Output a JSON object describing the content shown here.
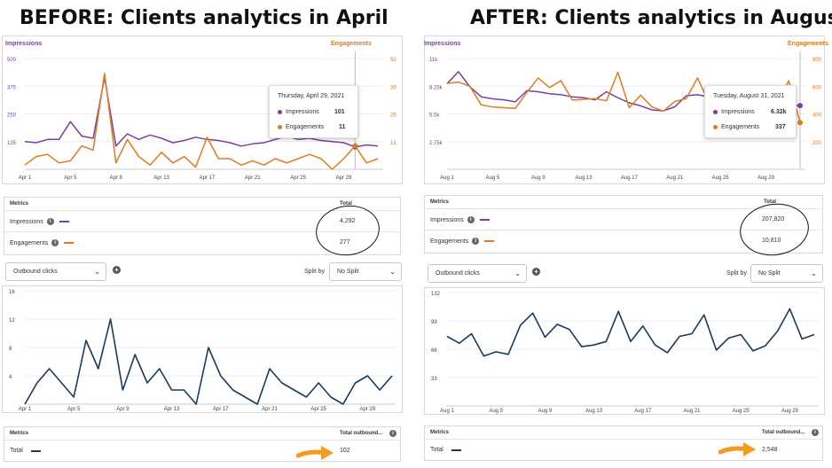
{
  "colors": {
    "impressions": "#7b3fa0",
    "engagements": "#e07b1f",
    "clicks": "#1b3a5c",
    "annotation_arrow": "#f39c1f"
  },
  "left": {
    "title": "BEFORE: Clients analytics in April",
    "top_legend": {
      "left": "Impressions",
      "right": "Engagements"
    },
    "tooltip": {
      "date": "Thursday, April 29, 2021",
      "impressions_label": "Impressions",
      "impressions_value": "101",
      "engagements_label": "Engagements",
      "engagements_value": "11"
    },
    "metrics_table": {
      "col_metric": "Metrics",
      "col_total": "Total",
      "rows": [
        {
          "label": "Impressions",
          "value": "4,292"
        },
        {
          "label": "Engagements",
          "value": "277"
        }
      ]
    },
    "dropdown": {
      "value": "Outbound clicks"
    },
    "split": {
      "label": "Split by",
      "value": "No Split"
    },
    "bottom_table": {
      "col_metric": "Metrics",
      "col_total": "Total outbound...",
      "row_label": "Total",
      "row_value": "102"
    }
  },
  "right": {
    "title": "AFTER: Clients analytics in August",
    "top_legend": {
      "left": "Impressions",
      "right": "Engagements"
    },
    "tooltip": {
      "date": "Tuesday, August 31, 2021",
      "impressions_label": "Impressions",
      "impressions_value": "6.32k",
      "engagements_label": "Engagements",
      "engagements_value": "337"
    },
    "metrics_table": {
      "col_metric": "Metrics",
      "col_total": "Total",
      "rows": [
        {
          "label": "Impressions",
          "value": "207,820"
        },
        {
          "label": "Engagements",
          "value": "10,810"
        }
      ]
    },
    "dropdown": {
      "value": "Outbound clicks"
    },
    "split": {
      "label": "Split by",
      "value": "No Split"
    },
    "bottom_table": {
      "col_metric": "Metrics",
      "col_total": "Total outbound...",
      "row_label": "Total",
      "row_value": "2,548"
    }
  },
  "chart_data": [
    {
      "id": "april-impressions-engagements",
      "type": "line",
      "x_ticks": [
        "Apr 1",
        "Apr 5",
        "Apr 9",
        "Apr 13",
        "Apr 17",
        "Apr 21",
        "Apr 25",
        "Apr 29"
      ],
      "y_left_ticks": [
        "500",
        "375",
        "250",
        "125"
      ],
      "y_left_range": [
        0,
        500
      ],
      "y_right_ticks": [
        "52",
        "39",
        "26",
        "13"
      ],
      "y_right_range": [
        0,
        52
      ],
      "series": [
        {
          "name": "Impressions",
          "axis": "left",
          "values": [
            125,
            120,
            135,
            135,
            215,
            150,
            140,
            415,
            105,
            160,
            135,
            155,
            140,
            120,
            130,
            145,
            135,
            130,
            120,
            105,
            115,
            120,
            135,
            150,
            135,
            140,
            130,
            125,
            120,
            101,
            110,
            105
          ]
        },
        {
          "name": "Engagements",
          "axis": "right",
          "values": [
            2,
            6,
            7,
            3,
            4,
            11,
            9,
            45,
            3,
            14,
            6,
            2,
            8,
            3,
            6,
            1,
            15,
            5,
            5,
            2,
            4,
            2,
            5,
            3,
            5,
            7,
            5,
            0,
            5,
            11,
            3,
            5
          ]
        }
      ]
    },
    {
      "id": "august-impressions-engagements",
      "type": "line",
      "x_ticks": [
        "Aug 1",
        "Aug 5",
        "Aug 9",
        "Aug 13",
        "Aug 17",
        "Aug 21",
        "Aug 25",
        "Aug 29"
      ],
      "y_left_ticks": [
        "11k",
        "8.25k",
        "5.5k",
        "2.75k"
      ],
      "y_left_range": [
        0,
        11000
      ],
      "y_right_ticks": [
        "800",
        "600",
        "400",
        "200"
      ],
      "y_right_range": [
        0,
        800
      ],
      "series": [
        {
          "name": "Impressions",
          "axis": "left",
          "values": [
            8500,
            9700,
            8200,
            7200,
            7000,
            6900,
            6700,
            7800,
            7700,
            7500,
            7400,
            7200,
            7100,
            6900,
            7700,
            7100,
            6600,
            6300,
            5900,
            5800,
            6200,
            7300,
            7400,
            7200,
            7300,
            7100,
            6900,
            7300,
            7700,
            6800,
            6400,
            6320
          ]
        },
        {
          "name": "Engagements",
          "axis": "right",
          "values": [
            620,
            630,
            600,
            465,
            450,
            445,
            440,
            555,
            660,
            590,
            640,
            500,
            505,
            510,
            495,
            700,
            445,
            535,
            450,
            420,
            490,
            510,
            660,
            480,
            440,
            485,
            545,
            560,
            500,
            470,
            640,
            337
          ]
        }
      ]
    },
    {
      "id": "april-outbound-clicks",
      "type": "line",
      "x_ticks": [
        "Apr 1",
        "Apr 5",
        "Apr 9",
        "Apr 13",
        "Apr 17",
        "Apr 21",
        "Apr 25",
        "Apr 29"
      ],
      "y_ticks": [
        "16",
        "12",
        "8",
        "4"
      ],
      "y_range": [
        0,
        16
      ],
      "series": [
        {
          "name": "Total",
          "values": [
            0,
            3,
            5,
            3,
            1,
            9,
            5,
            12,
            2,
            7,
            3,
            5,
            2,
            2,
            0,
            8,
            4,
            2,
            1,
            0,
            5,
            3,
            2,
            1,
            3,
            1,
            0,
            3,
            4,
            2,
            4
          ]
        }
      ]
    },
    {
      "id": "august-outbound-clicks",
      "type": "line",
      "x_ticks": [
        "Aug 1",
        "Aug 5",
        "Aug 9",
        "Aug 13",
        "Aug 17",
        "Aug 21",
        "Aug 25",
        "Aug 29"
      ],
      "y_ticks": [
        "132",
        "99",
        "66",
        "33"
      ],
      "y_range": [
        0,
        132
      ],
      "series": [
        {
          "name": "Total",
          "values": [
            81,
            73,
            84,
            58,
            63,
            60,
            94,
            108,
            80,
            95,
            89,
            69,
            71,
            75,
            110,
            75,
            93,
            71,
            62,
            81,
            84,
            106,
            65,
            79,
            83,
            64,
            70,
            87,
            113,
            78,
            83
          ]
        }
      ]
    }
  ]
}
